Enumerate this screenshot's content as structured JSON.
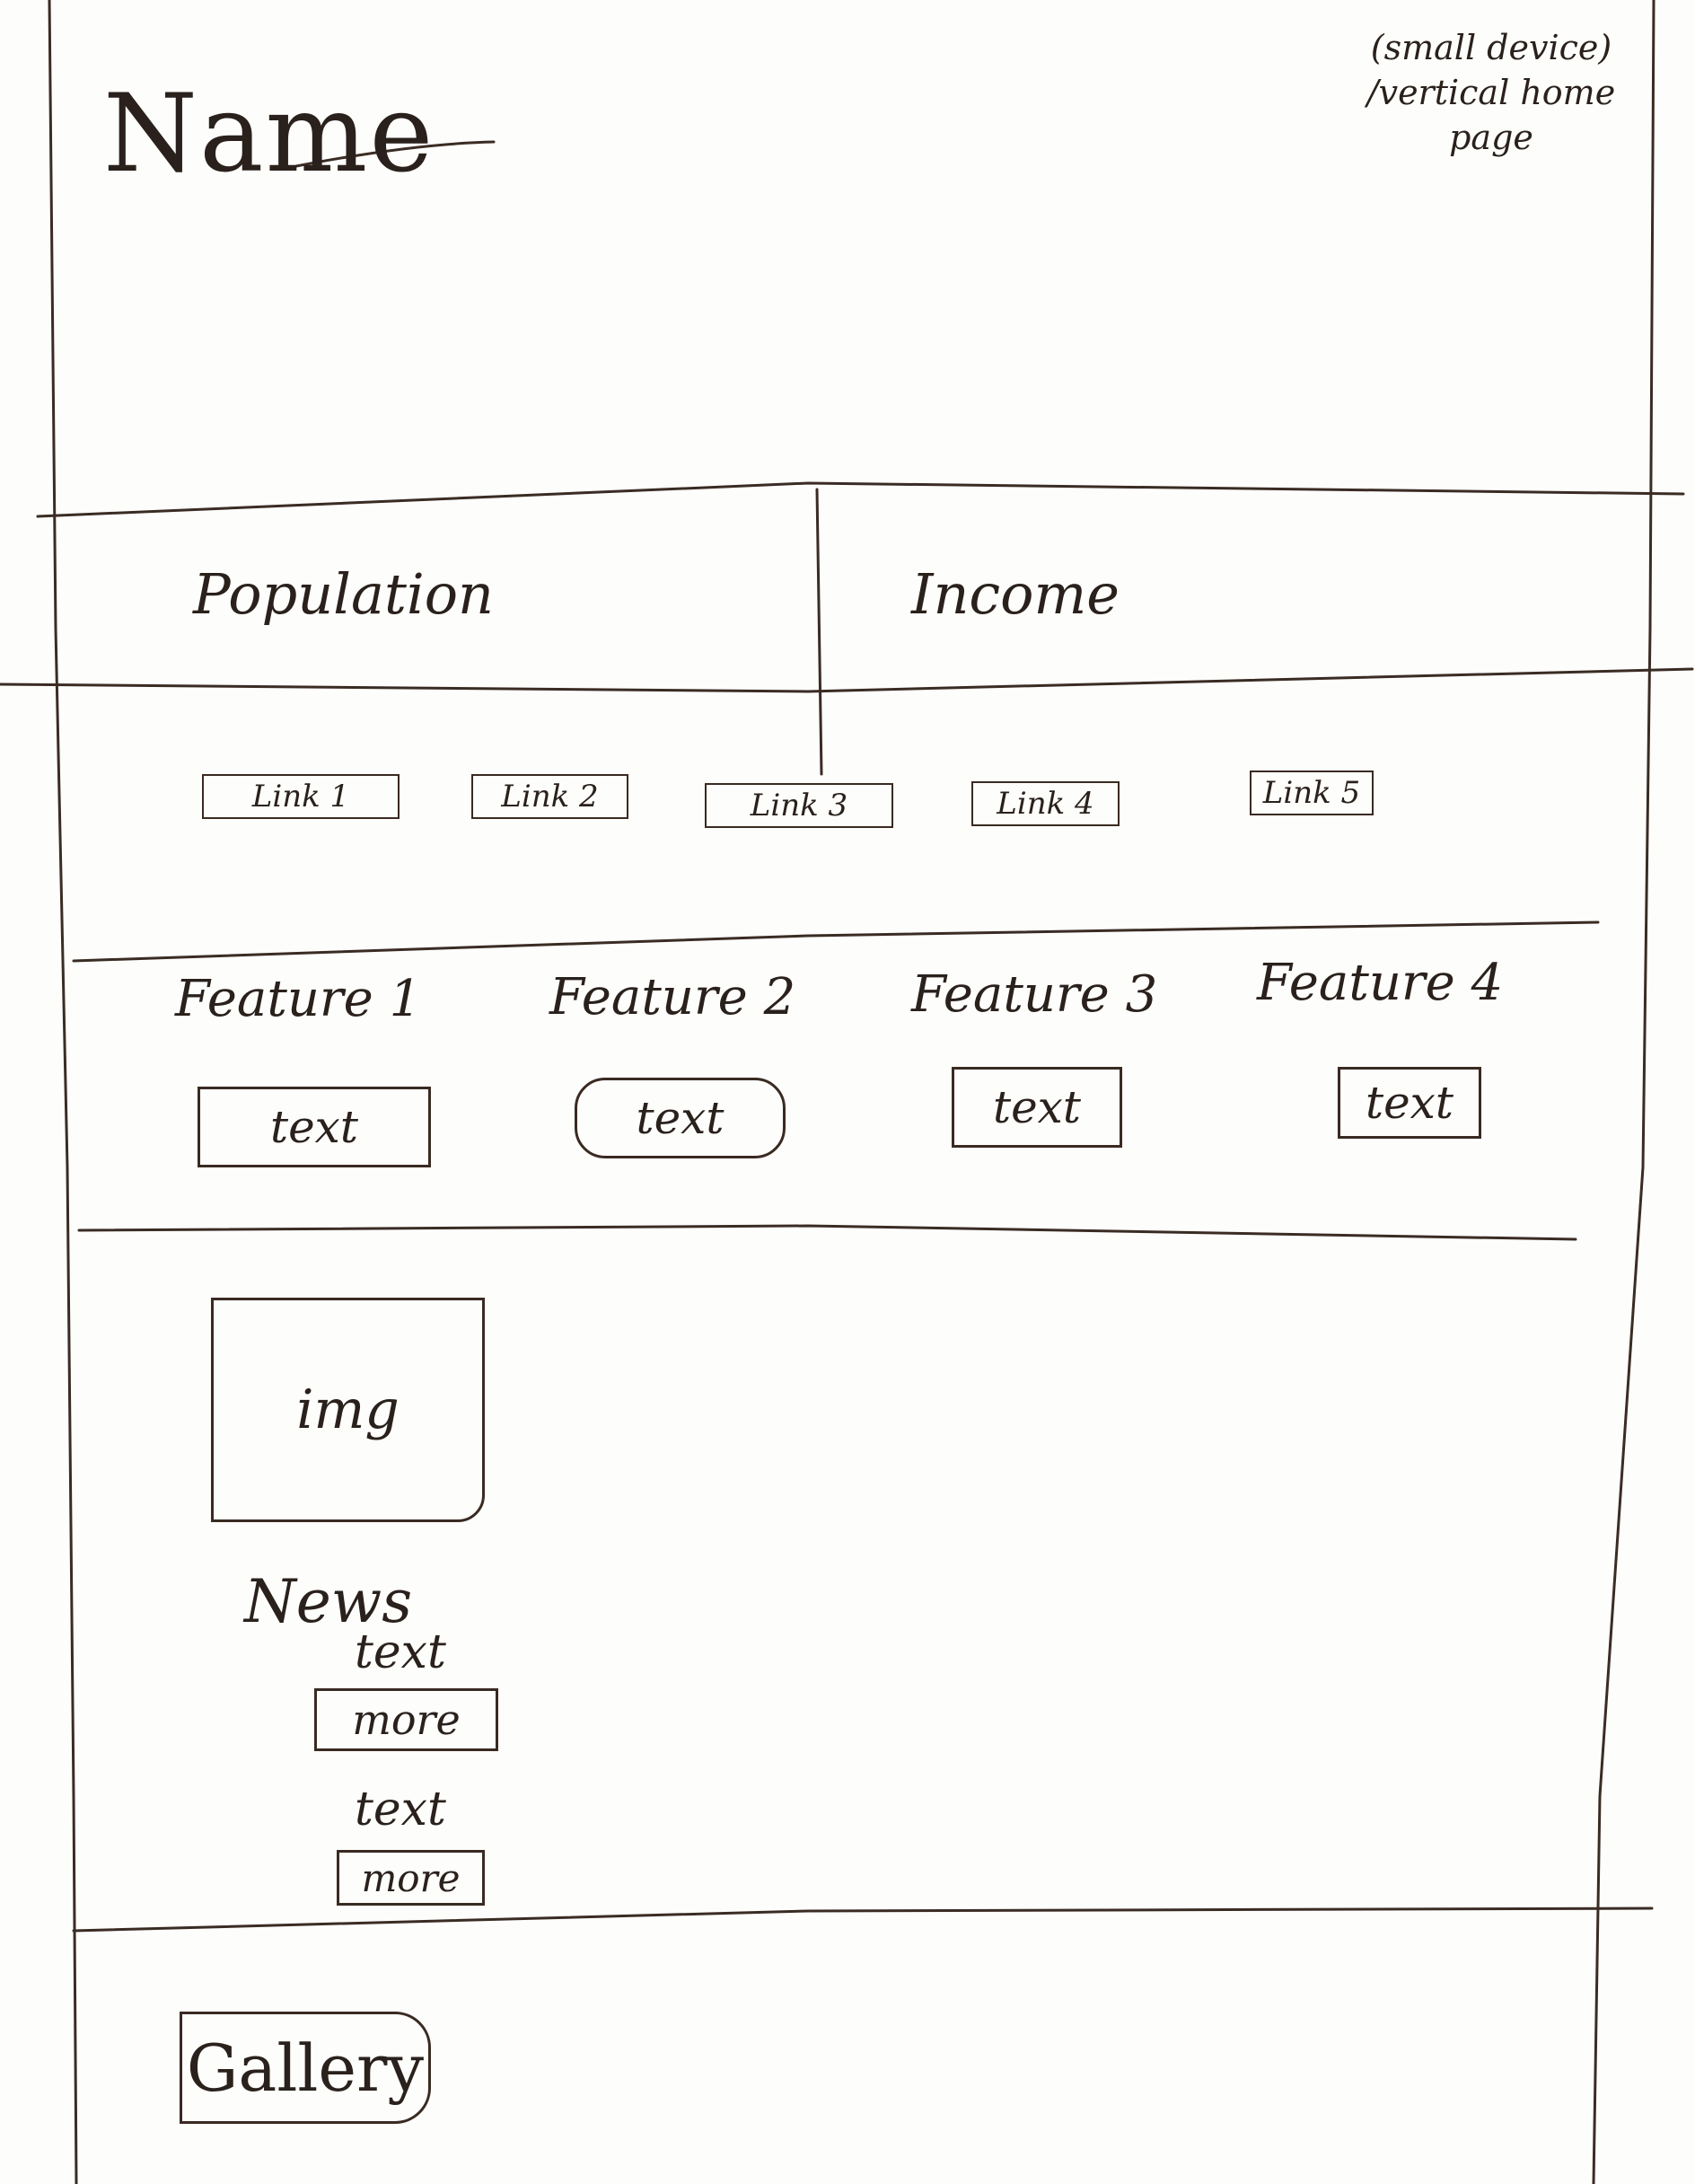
{
  "header": {
    "name": "Name",
    "note": "(small device) /vertical home page"
  },
  "stats": {
    "population": "Population",
    "income": "Income"
  },
  "links": [
    "Link 1",
    "Link 2",
    "Link 3",
    "Link 4",
    "Link 5"
  ],
  "features": [
    {
      "title": "Feature 1",
      "text": "text"
    },
    {
      "title": "Feature 2",
      "text": "text"
    },
    {
      "title": "Feature 3",
      "text": "text"
    },
    {
      "title": "Feature 4",
      "text": "text"
    }
  ],
  "news": {
    "image_label": "img",
    "title": "News",
    "items": [
      {
        "text": "text",
        "more": "more"
      },
      {
        "text": "text",
        "more": "more"
      }
    ]
  },
  "gallery": {
    "label": "Gallery"
  }
}
